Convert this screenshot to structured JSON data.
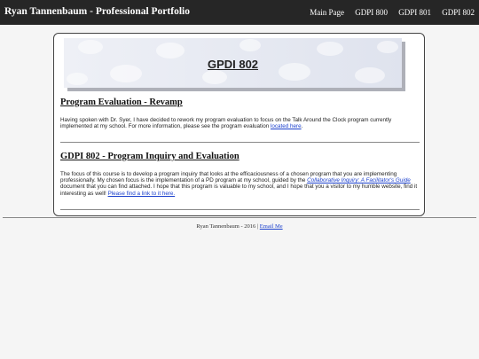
{
  "header": {
    "brand": "Ryan Tannenbaum - Professional Portfolio",
    "nav": [
      "Main Page",
      "GDPI 800",
      "GDPI 801",
      "GDPI 802"
    ]
  },
  "banner": {
    "title": "GPDI 802"
  },
  "sections": [
    {
      "heading": "Program Evaluation - Revamp",
      "text_before": "Having spoken with Dr. Syer, I have decided to rework my program evaluation to focus on the Talk Around the Clock program currently implemented at my school. For more information, please see the program evaluation ",
      "link": "located here",
      "text_after": "."
    },
    {
      "heading": "GDPI 802 - Program Inquiry and Evaluation",
      "text_before": "The focus of this course is to develop a program inquiry that looks at the efficaciousness of a chosen program that you are implementing professionally. My chosen focus is the implementation of a PD program at my school, guided by the ",
      "book_link": "Collaborative Inquiry: A Facilitator's Guide",
      "text_middle": " document that you can find attached. I hope that this program is valuable to my school, and I hope that you a visitor to my humble website, find it interesting as well! ",
      "link": "Please find a link to it here."
    }
  ],
  "footer": {
    "text": "Ryan Tannenbaum - 2016 | ",
    "link": "Email Me"
  },
  "colors": {
    "topbar": "#262626",
    "link": "#1a3fcc"
  }
}
